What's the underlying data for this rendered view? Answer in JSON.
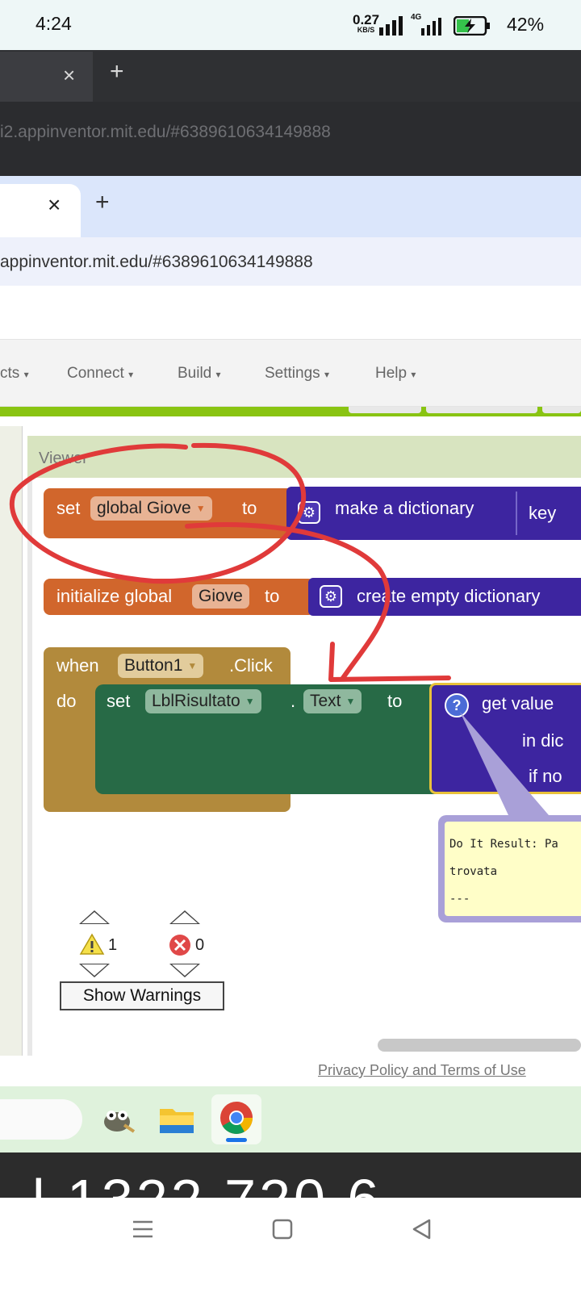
{
  "status_bar": {
    "time": "4:24",
    "net_speed_value": "0.27",
    "net_speed_unit": "KB/S",
    "network": "4G",
    "battery": "42%"
  },
  "outer_browser": {
    "tab_close": "×",
    "new_tab": "+",
    "url": "i2.appinventor.mit.edu/#6389610634149888"
  },
  "inner_browser": {
    "tab_close": "×",
    "new_tab": "+",
    "url": "appinventor.mit.edu/#6389610634149888"
  },
  "menu": {
    "items": [
      "cts",
      "Connect",
      "Build",
      "Settings",
      "Help"
    ],
    "caret": "▾"
  },
  "viewer": {
    "title": "Viewer"
  },
  "blocks": {
    "set_global": {
      "set": "set",
      "var": "global Giove",
      "to": "to",
      "call": "make a dictionary",
      "key": "key"
    },
    "init_global": {
      "label": "initialize global",
      "name": "Giove",
      "to": "to",
      "call": "create empty dictionary"
    },
    "event": {
      "when": "when",
      "component": "Button1",
      "event": ".Click",
      "do": "do"
    },
    "setter": {
      "set": "set",
      "component": "LblRisultato",
      "dot": ".",
      "property": "Text",
      "to": "to"
    },
    "get_value": {
      "q": "?",
      "line1": "get value",
      "line2": "in dic",
      "line3": "if no"
    },
    "result_bubble": {
      "line1": "Do It Result: Pa",
      "line2": "trovata",
      "line3": "---"
    }
  },
  "warnings": {
    "warning_count": "1",
    "error_count": "0",
    "show_button": "Show Warnings"
  },
  "footer": {
    "privacy": "Privacy Policy and Terms of Use"
  },
  "dark_strip": {
    "text": "l 1322  720 6"
  },
  "colors": {
    "set_block": "#d1662c",
    "dictionary_block": "#3d25a0",
    "event_block": "#b28a3c",
    "setter_block": "#276a46",
    "annotation_red": "#e03a3a"
  }
}
